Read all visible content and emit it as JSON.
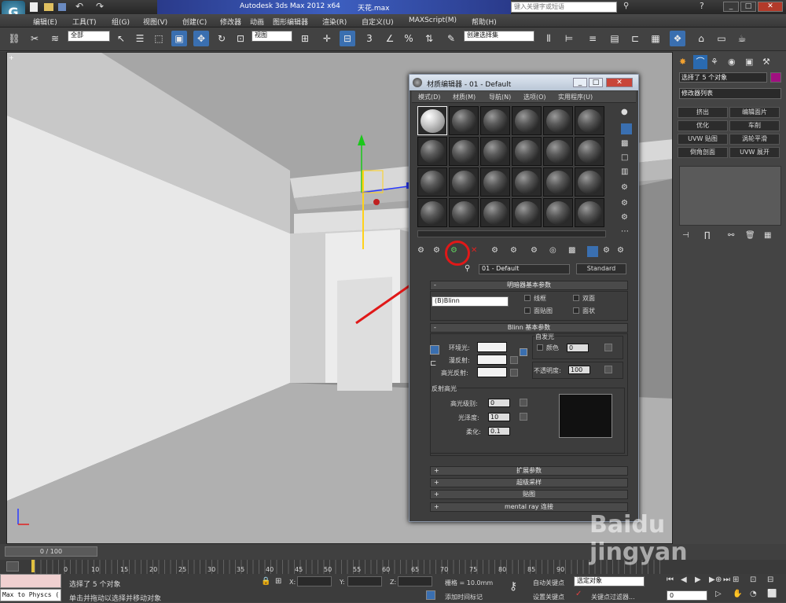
{
  "app": {
    "title": "Autodesk 3ds Max  2012 x64",
    "file": "天花.max",
    "search_placeholder": "键入关键字或短语"
  },
  "menus": [
    "编辑(E)",
    "工具(T)",
    "组(G)",
    "视图(V)",
    "创建(C)",
    "修改器",
    "动画",
    "图形编辑器",
    "渲染(R)",
    "自定义(U)",
    "MAXScript(M)",
    "帮助(H)"
  ],
  "toolbar": {
    "selection_filter": "全部",
    "ref_coord": "视图",
    "snap_3": "3",
    "snap_pct": "%",
    "named_selection": "创建选择集"
  },
  "material_editor": {
    "title": "材质编辑器 - 01 - Default",
    "menu": [
      "模式(D)",
      "材质(M)",
      "导航(N)",
      "选项(O)",
      "实用程序(U)"
    ],
    "material_name": "01 - Default",
    "material_type": "Standard",
    "shader_params": {
      "header": "明暗器基本参数",
      "shader": "(B)Blinn",
      "wire": "线框",
      "two_sided": "双面",
      "face_map": "面贴图",
      "faceted": "面状"
    },
    "blinn": {
      "header": "Blinn 基本参数",
      "self_illum": "自发光",
      "color_label": "颜色",
      "color_value": "0",
      "ambient": "环境光:",
      "diffuse": "漫反射:",
      "specular": "高光反射:",
      "opacity_label": "不透明度:",
      "opacity_value": "100",
      "spec_hl_header": "反射高光",
      "spec_level_label": "高光级别:",
      "spec_level": "0",
      "glossiness_label": "光泽度:",
      "glossiness": "10",
      "soften_label": "柔化:",
      "soften": "0.1"
    },
    "rollouts": [
      "扩展参数",
      "超级采样",
      "贴图",
      "mental ray 连接"
    ]
  },
  "command_panel": {
    "selection_text": "选择了 5 个对象",
    "modifier_list": "修改器列表",
    "buttons": [
      "挤出",
      "编辑面片",
      "优化",
      "车削",
      "UVW 贴图",
      "涡轮平滑",
      "倒角剖面",
      "UVW 展开"
    ]
  },
  "timeline": {
    "frame": "0 / 100",
    "ticks": [
      "0",
      "5",
      "10",
      "15",
      "20",
      "25",
      "30",
      "35",
      "40",
      "45",
      "50",
      "55",
      "60",
      "65",
      "70",
      "75",
      "80",
      "85",
      "90"
    ]
  },
  "status": {
    "script_label": "Max to Physcs (",
    "selected": "选择了 5 个对象",
    "prompt": "单击并拖动以选择并移动对象",
    "x_label": "X:",
    "y_label": "Y:",
    "z_label": "Z:",
    "grid": "栅格 = 10.0mm",
    "add_time_tag": "添加时间标记",
    "auto_key": "自动关键点",
    "set_key": "设置关键点",
    "selected_obj": "选定对象",
    "key_filters": "关键点过滤器...",
    "frame_value": "0"
  },
  "watermark": "Baidu jingyan"
}
